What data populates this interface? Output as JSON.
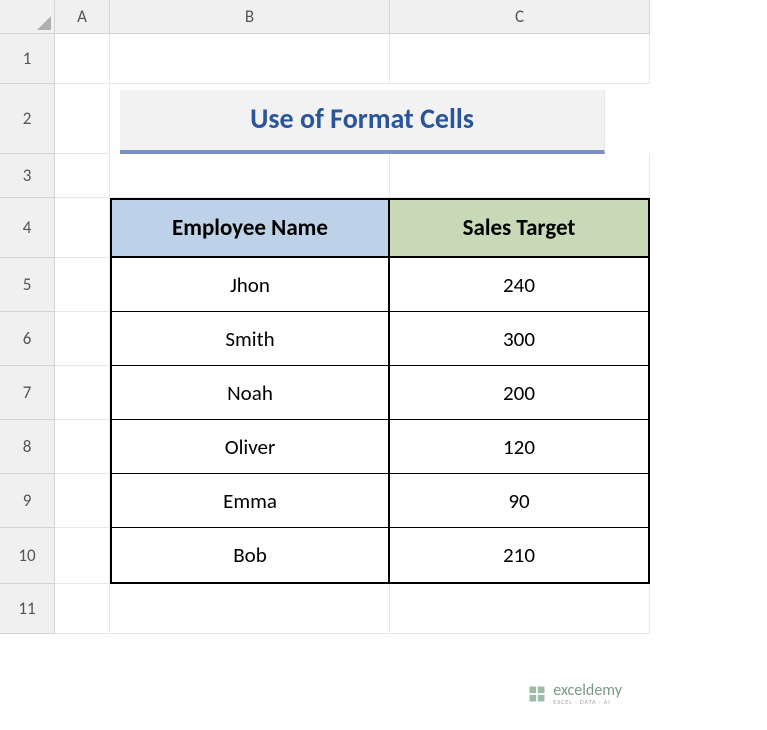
{
  "columns": [
    "A",
    "B",
    "C"
  ],
  "rows": [
    "1",
    "2",
    "3",
    "4",
    "5",
    "6",
    "7",
    "8",
    "9",
    "10",
    "11"
  ],
  "title": "Use of Format Cells",
  "table": {
    "headers": {
      "col1": "Employee Name",
      "col2": "Sales Target"
    },
    "data": [
      {
        "name": "Jhon",
        "target": "240"
      },
      {
        "name": "Smith",
        "target": "300"
      },
      {
        "name": "Noah",
        "target": "200"
      },
      {
        "name": "Oliver",
        "target": "120"
      },
      {
        "name": "Emma",
        "target": "90"
      },
      {
        "name": "Bob",
        "target": "210"
      }
    ]
  },
  "watermark": {
    "main": "exceldemy",
    "sub": "EXCEL · DATA · AI"
  }
}
